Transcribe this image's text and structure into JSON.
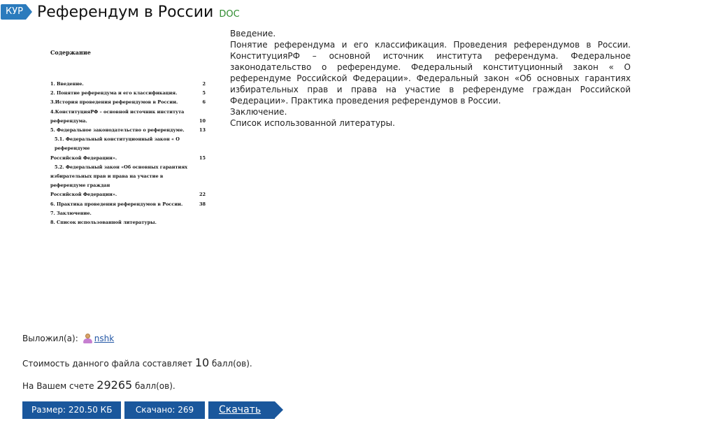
{
  "header": {
    "badge": "КУР",
    "title": "Референдум в России",
    "doc_type": "DOC"
  },
  "preview": {
    "heading": "Содержание",
    "toc": [
      {
        "text": "1. Введение.",
        "page": "2"
      },
      {
        "text": "2. Понятие референдума и его классификация.",
        "page": "5"
      },
      {
        "text": "3.История проведения референдумов в России.",
        "page": "6"
      },
      {
        "text": "4.КонституцияРФ – основной источник института",
        "page": ""
      },
      {
        "text": "референдума.",
        "page": "10"
      },
      {
        "text": "5. Федеральное законодательство о референдуме.",
        "page": "13"
      },
      {
        "text": "5.1. Федеральный конституционный закон « О референдуме",
        "page": ""
      },
      {
        "text": "Российской Федерации».",
        "page": "15"
      },
      {
        "text": "5.2. Федеральный закон «Об основных гарантиях",
        "page": ""
      },
      {
        "text": "избирательных прав и права на участие в референдуме граждан",
        "page": ""
      },
      {
        "text": "Российской Федерации».",
        "page": "22"
      },
      {
        "text": "6. Практика проведения референдумов в России.",
        "page": "38"
      },
      {
        "text": "7. Заключение.",
        "page": ""
      },
      {
        "text": "8. Список использованной литературы.",
        "page": ""
      }
    ]
  },
  "description": {
    "line1": "Введение.",
    "paragraph": "Понятие референдума и его классификация. Проведения референдумов в России. КонституцияРФ – основной источник института референдума. Федеральное законодательство о референдуме. Федеральный конституционный закон « О референдуме Российской Федерации». Федеральный закон «Об основных гарантиях избирательных прав и права на участие в референдуме граждан Российской Федерации». Практика проведения референдумов в России.",
    "line3": "Заключение.",
    "line4": "Список использованной литературы."
  },
  "uploader": {
    "label": "Выложил(а):",
    "icon": "user-icon",
    "name": "nshk"
  },
  "cost": {
    "prefix": "Стоимость данного файла составляет",
    "value": "10",
    "suffix": "балл(ов)."
  },
  "balance": {
    "prefix": "На Вашем счете",
    "value": "29265",
    "suffix": "балл(ов)."
  },
  "file": {
    "size_label": "Размер: 220.50 КБ",
    "downloads_label": "Скачано: 269",
    "download_button": "Скачать"
  },
  "colors": {
    "badge": "#2b7bbd",
    "doc_type": "#2e8b2e",
    "button": "#1a579c",
    "link": "#2256a5"
  }
}
